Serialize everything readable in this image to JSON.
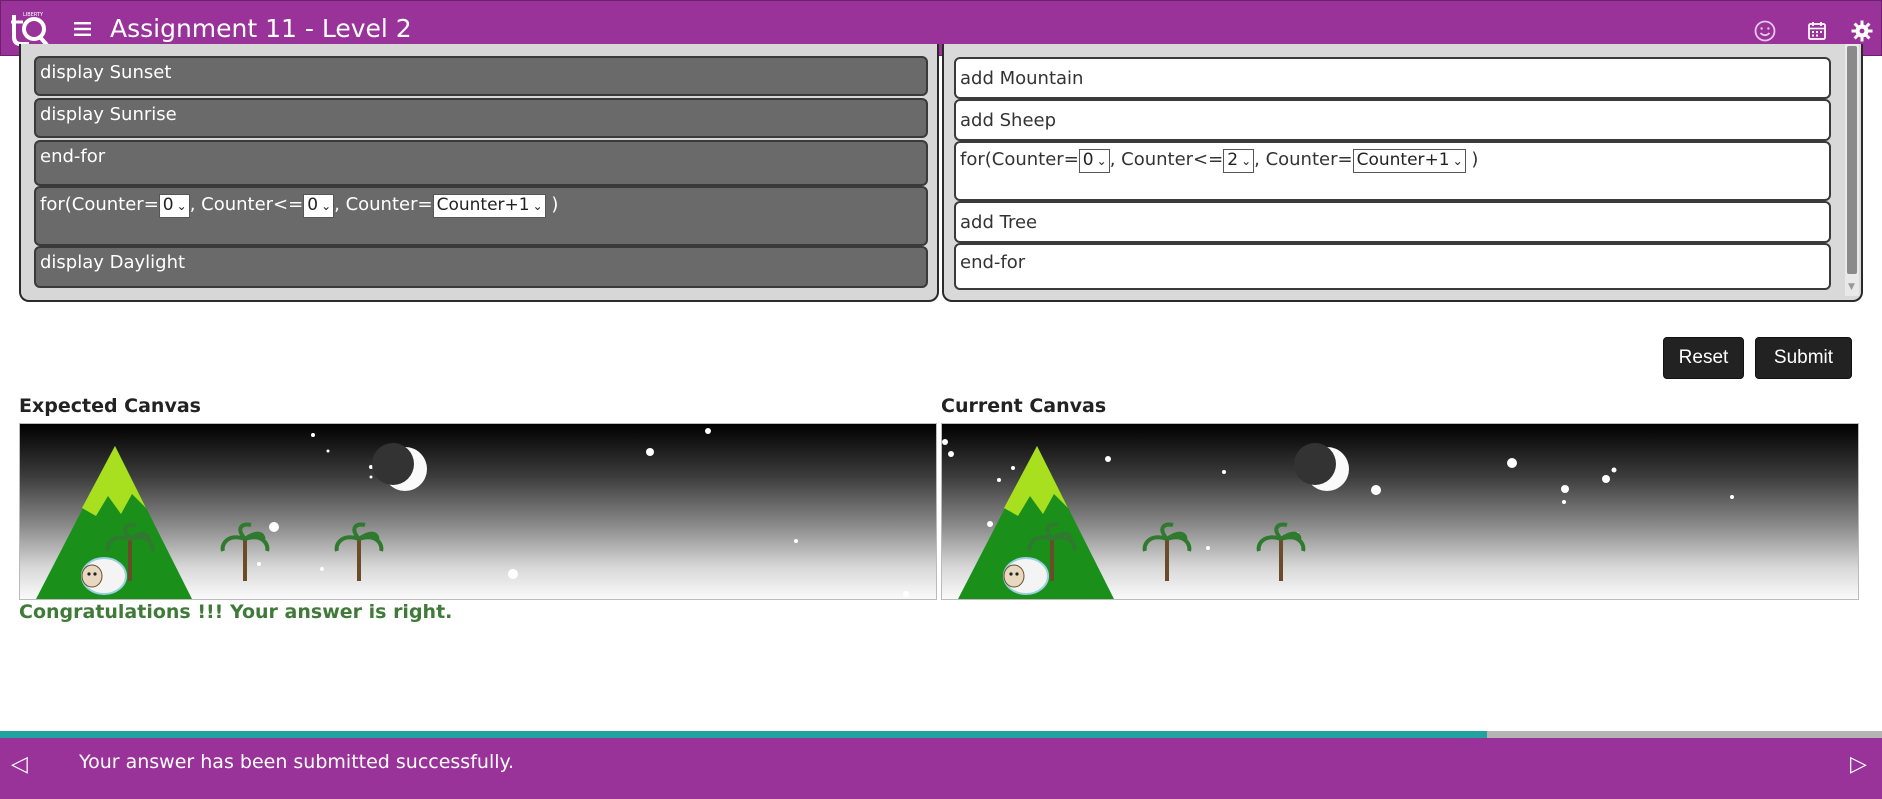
{
  "header": {
    "title": "Assignment 11 - Level 2",
    "bg_color": "#993399"
  },
  "left_blocks": [
    {
      "label": "display Sunset"
    },
    {
      "label": "display Sunrise"
    },
    {
      "label": "end-for"
    },
    {
      "prefix": "for(Counter=",
      "init": "0",
      "mid": ", Counter<=",
      "limit": "0",
      "mid2": ", Counter=",
      "step": "Counter+1",
      "suffix": ")"
    },
    {
      "label": "display Daylight"
    }
  ],
  "right_blocks": [
    {
      "label": "add Mountain"
    },
    {
      "label": "add Sheep"
    },
    {
      "prefix": "for(Counter=",
      "init": "0",
      "mid": ", Counter<=",
      "limit": "2",
      "mid2": ", Counter=",
      "step": "Counter+1",
      "suffix": ")"
    },
    {
      "label": "add Tree"
    },
    {
      "label": "end-for"
    }
  ],
  "buttons": {
    "reset": "Reset",
    "submit": "Submit"
  },
  "canvases": {
    "expected_title": "Expected Canvas",
    "current_title": "Current Canvas"
  },
  "result_message": "Congratulations !!! Your answer is right.",
  "progress": {
    "percent": 79,
    "color": "#22a3a0"
  },
  "footer": {
    "message": "Your answer has been submitted successfully."
  },
  "icons": [
    "logo-icon",
    "menu-icon",
    "smiley-icon",
    "calendar-icon",
    "settings-icon",
    "prev-arrow-icon",
    "next-arrow-icon",
    "chevron-down-icon"
  ]
}
